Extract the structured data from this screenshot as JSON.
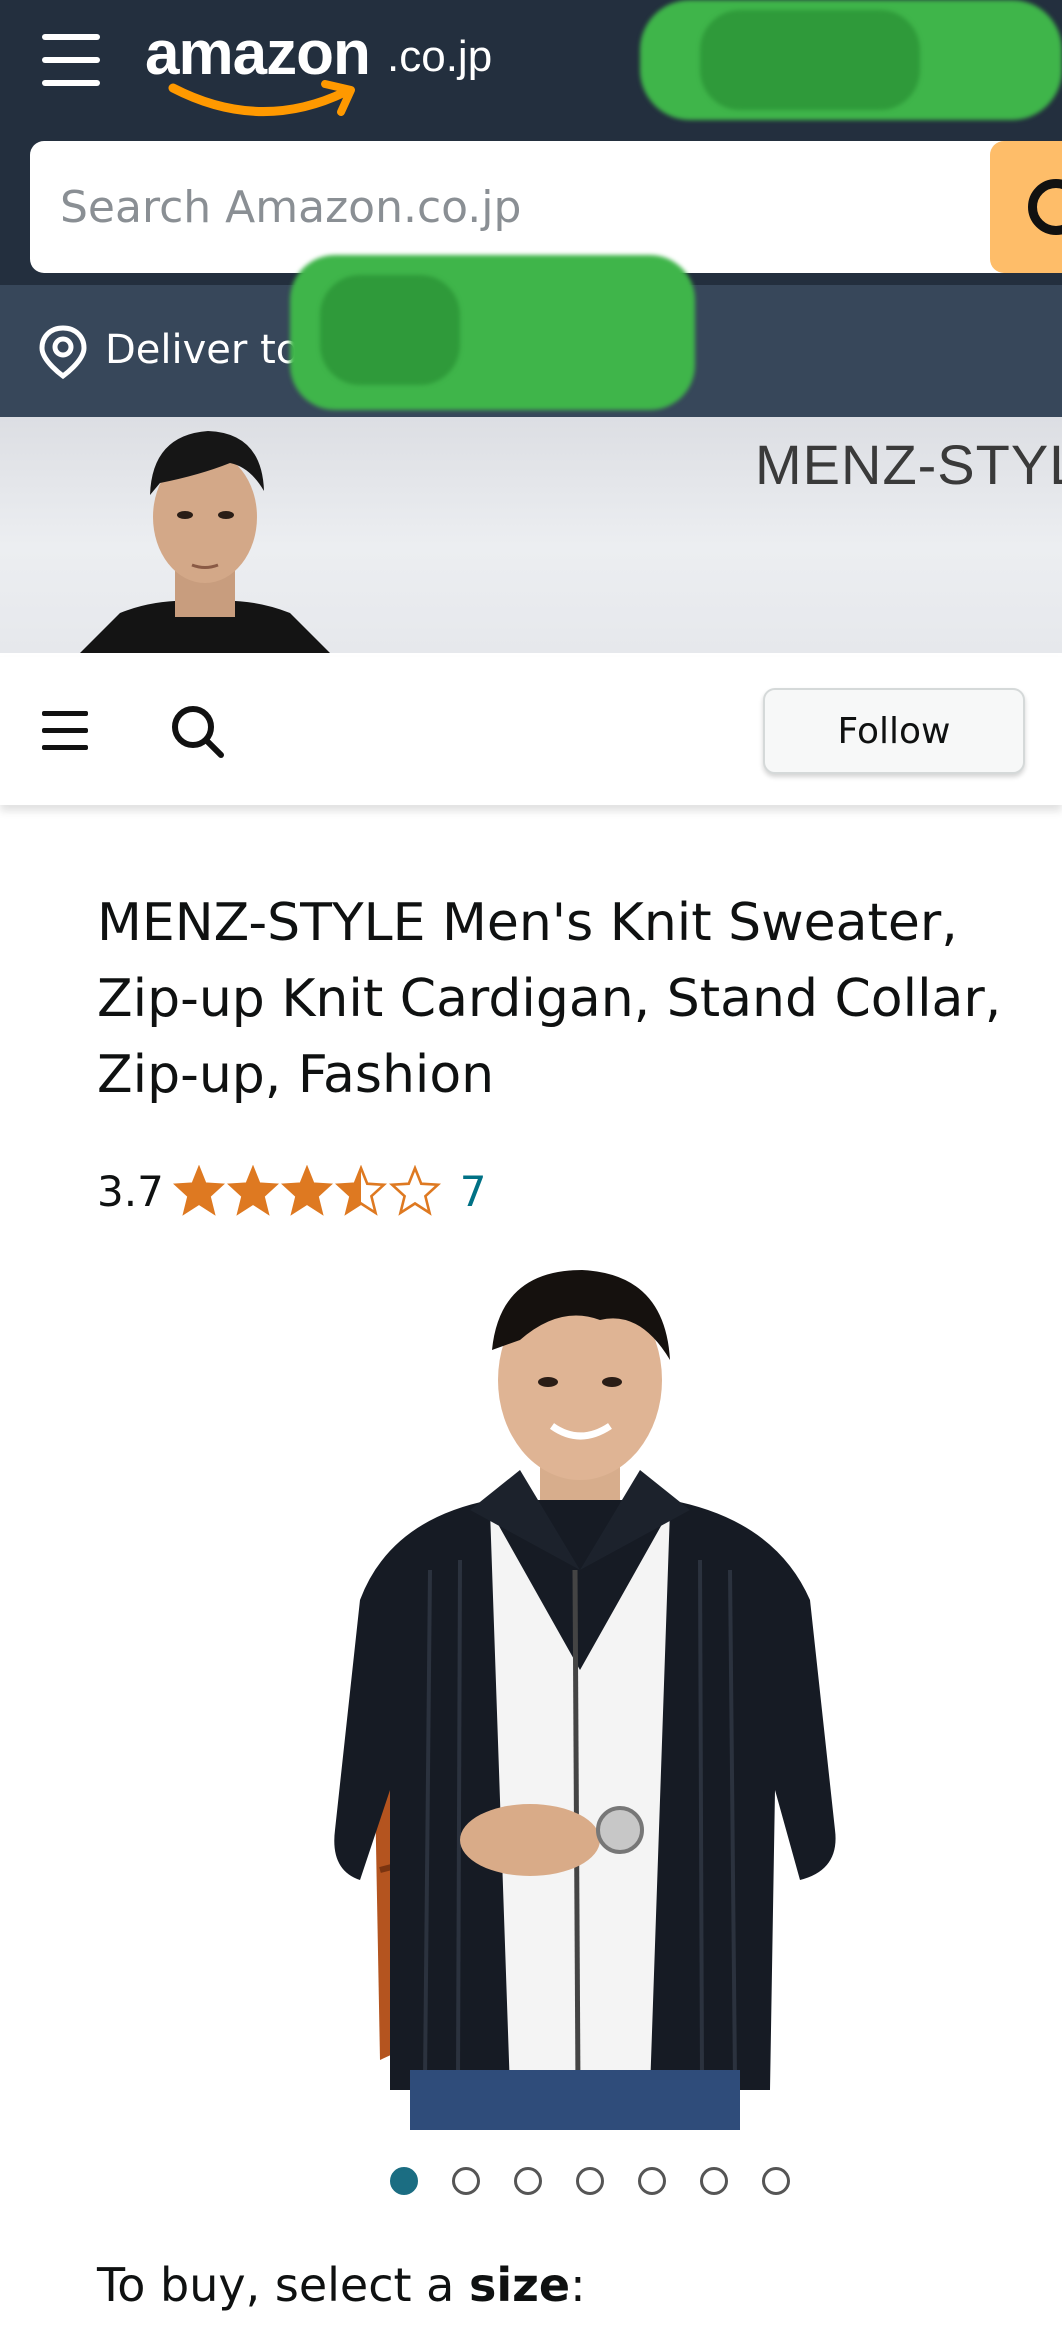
{
  "header": {
    "logo_word": "amazon",
    "logo_suffix": ".co.jp",
    "menu_icon": "hamburger-menu-icon"
  },
  "search": {
    "placeholder": "Search Amazon.co.jp",
    "value": "",
    "button_icon": "search-icon"
  },
  "delivery": {
    "icon": "location-pin-icon",
    "label": "Deliver to"
  },
  "store_banner": {
    "brand_name": "MENZ-STYL"
  },
  "store_nav": {
    "menu_icon": "menu-icon",
    "search_icon": "search-icon",
    "follow_label": "Follow"
  },
  "product": {
    "title": "MENZ-STYLE Men's Knit Sweater, Zip-up Knit Cardigan, Stand Collar, Zip-up, Fashion",
    "rating": "3.7",
    "rating_value": 3.7,
    "rating_max": 5,
    "review_count": "7",
    "image_count": 7,
    "active_image_index": 0
  },
  "buy_prompt": {
    "prefix": "To buy, select a ",
    "emphasis": "size",
    "suffix": ":"
  },
  "colors": {
    "header_bg": "#232f3e",
    "deliver_bg": "#37475a",
    "search_button": "#febd69",
    "star": "#de7921",
    "link": "#007185",
    "active_dot": "#1b6d82"
  }
}
